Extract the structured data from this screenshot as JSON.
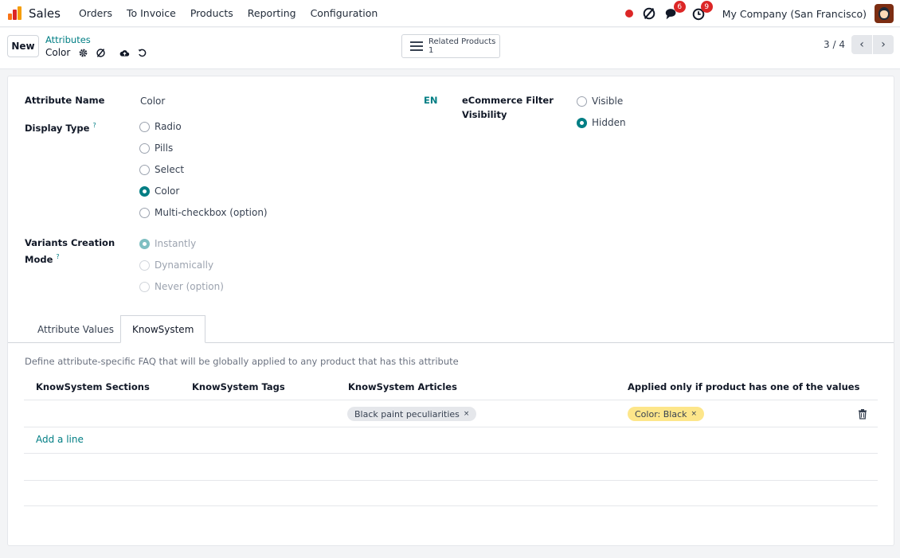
{
  "navbar": {
    "app_name": "Sales",
    "menu": [
      "Orders",
      "To Invoice",
      "Products",
      "Reporting",
      "Configuration"
    ],
    "messages_badge": "6",
    "activities_badge": "9",
    "company": "My Company (San Francisco)",
    "icons": [
      "sales-app-logo",
      "recording-dot",
      "voip-icon",
      "chat-icon",
      "clock-icon",
      "avatar"
    ]
  },
  "control": {
    "new_label": "New",
    "breadcrumb": "Attributes",
    "record_name": "Color",
    "smart_button": {
      "label": "Related Products",
      "value": "1"
    },
    "pager": "3 / 4"
  },
  "form": {
    "attribute_name_label": "Attribute Name",
    "attribute_name_value": "Color",
    "lang": "EN",
    "display_type_label": "Display Type",
    "help_mark": "?",
    "display_options": [
      "Radio",
      "Pills",
      "Select",
      "Color",
      "Multi-checkbox (option)"
    ],
    "display_selected": "Color",
    "variants_label_1": "Variants Creation",
    "variants_label_2": "Mode",
    "variants_options": [
      "Instantly",
      "Dynamically",
      "Never (option)"
    ],
    "variants_selected": "Instantly",
    "ecommerce_label_1": "eCommerce Filter",
    "ecommerce_label_2": "Visibility",
    "ecommerce_options": [
      "Visible",
      "Hidden"
    ],
    "ecommerce_selected": "Hidden"
  },
  "tabs": [
    "Attribute Values",
    "KnowSystem"
  ],
  "active_tab": "KnowSystem",
  "knowsystem": {
    "description": "Define attribute-specific FAQ that will be globally applied to any product that has this attribute",
    "columns": [
      "KnowSystem Sections",
      "KnowSystem Tags",
      "KnowSystem Articles",
      "Applied only if product has one of the values"
    ],
    "rows": [
      {
        "sections": "",
        "tags": "",
        "article_tag": "Black paint peculiarities",
        "value_tag": "Color: Black"
      }
    ],
    "tag_remove": "×",
    "add_line": "Add a line"
  },
  "colors": {
    "primary": "#017e84",
    "badge": "#dc2626",
    "tag_gray": "#e5e7eb",
    "tag_yellow": "#fde68a"
  }
}
